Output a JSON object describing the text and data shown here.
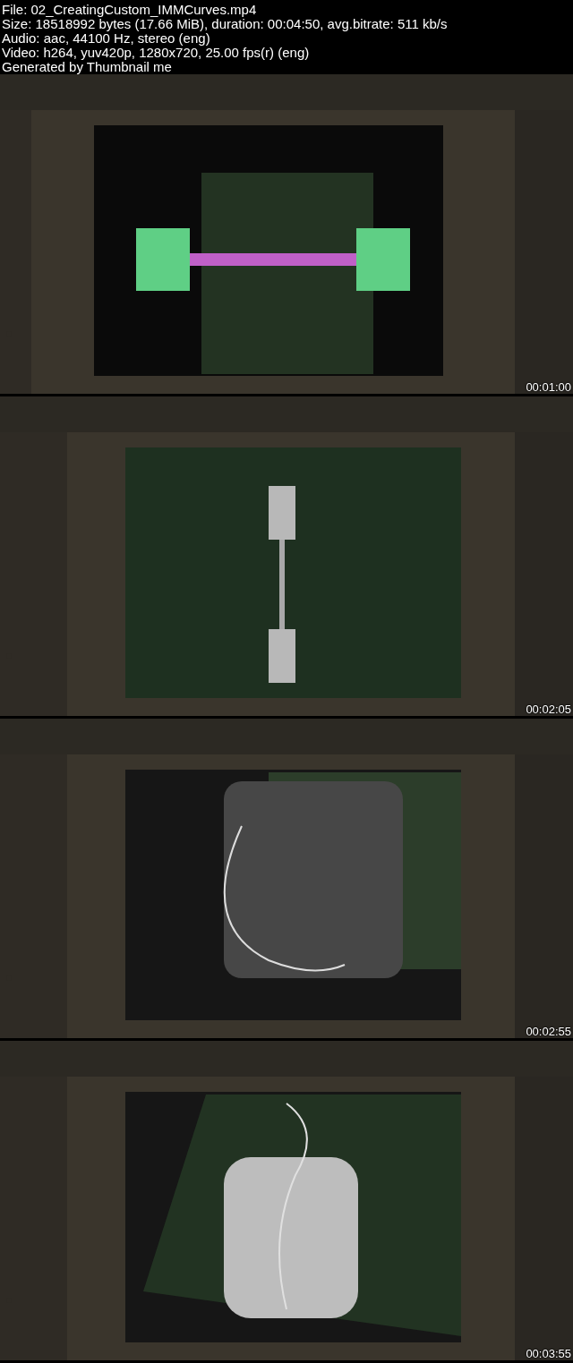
{
  "header": {
    "lines": [
      "File: 02_CreatingCustom_IMMCurves.mp4",
      "Size: 18518992 bytes (17.66 MiB), duration: 00:04:50, avg.bitrate: 511 kb/s",
      "Audio: aac, 44100 Hz, stereo (eng)",
      "Video: h264, yuv420p, 1280x720, 25.00 fps(r) (eng)",
      "Generated by Thumbnail me"
    ]
  },
  "frames": [
    {
      "kind": "picture",
      "timestamp": "00:01:00"
    },
    {
      "kind": "picture",
      "timestamp": "00:02:05"
    },
    {
      "kind": "picture",
      "timestamp": "00:02:55"
    },
    {
      "kind": "picture",
      "timestamp": "00:03:55"
    }
  ]
}
